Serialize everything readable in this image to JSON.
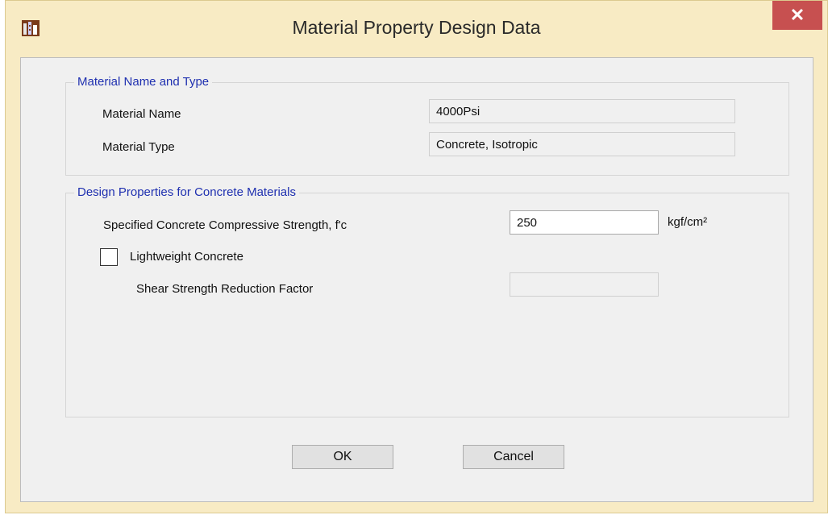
{
  "window": {
    "title": "Material Property Design Data",
    "close_symbol": "✕",
    "accent_close": "#c75050",
    "frame_color": "#f8ebc4"
  },
  "group_name_type": {
    "title": "Material Name and Type",
    "material_name_label": "Material Name",
    "material_name_value": "4000Psi",
    "material_type_label": "Material Type",
    "material_type_value": "Concrete, Isotropic"
  },
  "group_design": {
    "title": "Design Properties for Concrete Materials",
    "fc_label": "Specified Concrete Compressive Strength, f'c",
    "fc_value": "250",
    "fc_unit": "kgf/cm²",
    "lightweight_label": "Lightweight Concrete",
    "lightweight_checked": false,
    "shear_label": "Shear Strength Reduction Factor",
    "shear_value": ""
  },
  "buttons": {
    "ok": "OK",
    "cancel": "Cancel"
  },
  "icons": {
    "app": "etabs-app-icon",
    "close": "close-icon"
  }
}
